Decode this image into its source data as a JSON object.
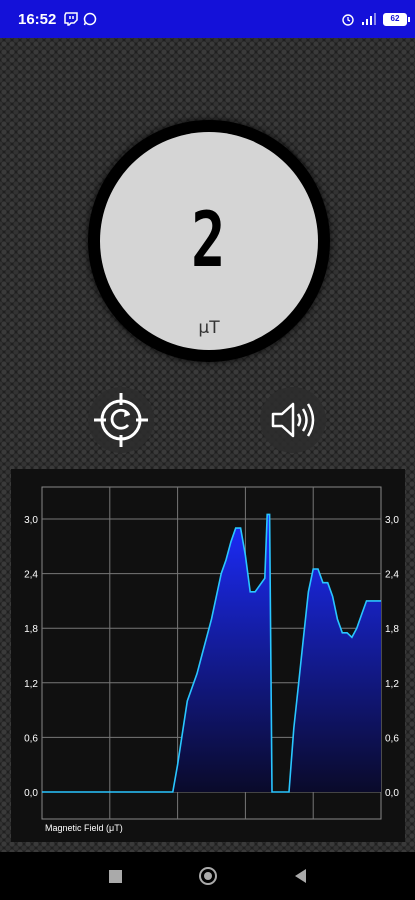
{
  "status_bar": {
    "time": "16:52",
    "left_icons": [
      "twitch-icon",
      "whatsapp-icon"
    ],
    "right_icons": [
      "alarm-icon",
      "signal-icon",
      "battery-icon"
    ],
    "battery_level": "62"
  },
  "gauge": {
    "value": "2",
    "unit": "μT"
  },
  "controls": {
    "reset_icon": "reset-icon",
    "sound_icon": "speaker-icon"
  },
  "chart_data": {
    "type": "area",
    "legend": "Magnetic Field (μT)",
    "ylim": [
      0,
      3.0
    ],
    "y_ticks": [
      "3,0",
      "2,4",
      "1,8",
      "1,2",
      "0,6",
      "0,0"
    ],
    "y_tick_values": [
      3.0,
      2.4,
      1.8,
      1.2,
      0.6,
      0.0
    ],
    "grid": true,
    "x": [
      0,
      10,
      20,
      26,
      27,
      28,
      30,
      32,
      33,
      35,
      37,
      38,
      39,
      40,
      41,
      42,
      43,
      44,
      46,
      46.5,
      47,
      47.5,
      48,
      48.5,
      49,
      49.5,
      50,
      51,
      52,
      53,
      54,
      55,
      56,
      57,
      58,
      59,
      60,
      61,
      62,
      63,
      64,
      65,
      66,
      67,
      68,
      69,
      70
    ],
    "values": [
      0,
      0,
      0,
      0,
      0,
      0.3,
      1.0,
      1.3,
      1.5,
      1.9,
      2.4,
      2.55,
      2.75,
      2.9,
      2.9,
      2.6,
      2.2,
      2.2,
      2.35,
      3.05,
      3.05,
      0.0,
      0.0,
      0.0,
      0.0,
      0.0,
      0.0,
      0.0,
      0.7,
      1.2,
      1.7,
      2.2,
      2.45,
      2.45,
      2.3,
      2.3,
      2.15,
      1.9,
      1.75,
      1.75,
      1.7,
      1.8,
      1.95,
      2.1,
      2.1,
      2.1,
      2.1
    ],
    "series": [
      {
        "values_ref": "values",
        "color": "#1a2aff"
      }
    ]
  },
  "nav_bar": {
    "buttons": [
      "recents",
      "home",
      "back"
    ]
  }
}
